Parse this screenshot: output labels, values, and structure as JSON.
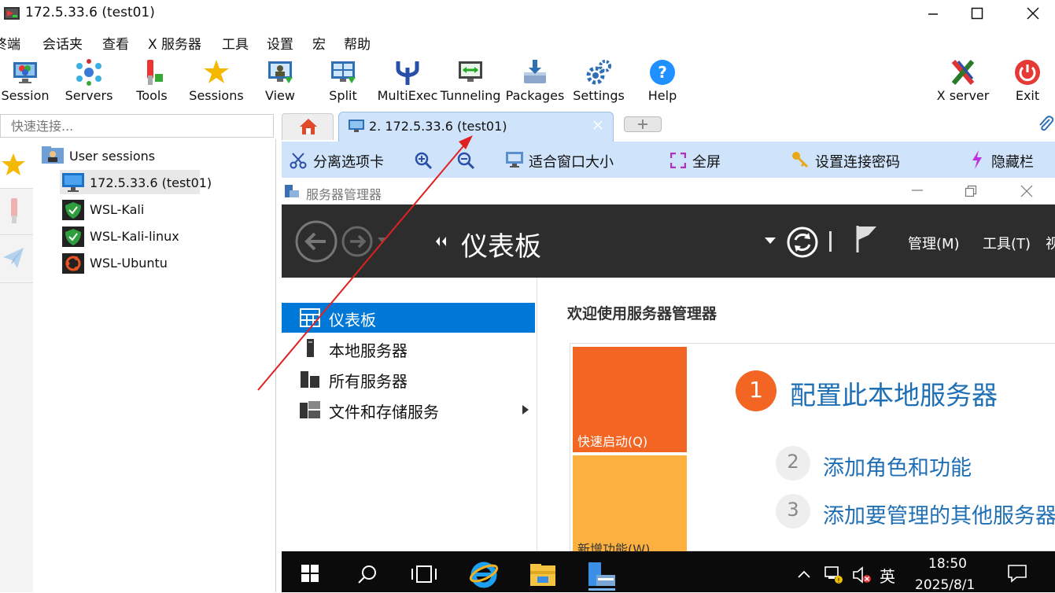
{
  "window": {
    "title": "172.5.33.6 (test01)"
  },
  "menu": [
    "终端",
    "会话夹",
    "查看",
    "X 服务器",
    "工具",
    "设置",
    "宏",
    "帮助"
  ],
  "toolbar": {
    "items": [
      "Session",
      "Servers",
      "Tools",
      "Sessions",
      "View",
      "Split",
      "MultiExec",
      "Tunneling",
      "Packages",
      "Settings",
      "Help"
    ],
    "xserver": "X server",
    "exit": "Exit"
  },
  "quick_connect": {
    "placeholder": "快速连接..."
  },
  "tabs": {
    "active": "2. 172.5.33.6 (test01)"
  },
  "tree": {
    "root": "User sessions",
    "items": [
      "172.5.33.6 (test01)",
      "WSL-Kali",
      "WSL-Kali-linux",
      "WSL-Ubuntu"
    ]
  },
  "remote_toolbar": {
    "detach": "分离选项卡",
    "fit": "适合窗口大小",
    "fullscreen": "全屏",
    "password": "设置连接密码",
    "hide": "隐藏栏"
  },
  "server_manager": {
    "window_title": "服务器管理器",
    "header_title": "仪表板",
    "menu_manage": "管理(M)",
    "menu_tools": "工具(T)",
    "menu_view": "视",
    "nav": [
      "仪表板",
      "本地服务器",
      "所有服务器",
      "文件和存储服务"
    ],
    "welcome": "欢迎使用服务器管理器",
    "quick_start": "快速启动(Q)",
    "new_features": "新增功能(W)",
    "steps": [
      {
        "num": "1",
        "label": "配置此本地服务器"
      },
      {
        "num": "2",
        "label": "添加角色和功能"
      },
      {
        "num": "3",
        "label": "添加要管理的其他服务器"
      }
    ]
  },
  "taskbar": {
    "ime": "英",
    "time": "18:50",
    "date": "2025/8/1"
  },
  "colors": {
    "accent_blue": "#0078d7",
    "tile_orange": "#f26522",
    "tile_yellow": "#fbb040",
    "annotation_red": "#e02020"
  }
}
